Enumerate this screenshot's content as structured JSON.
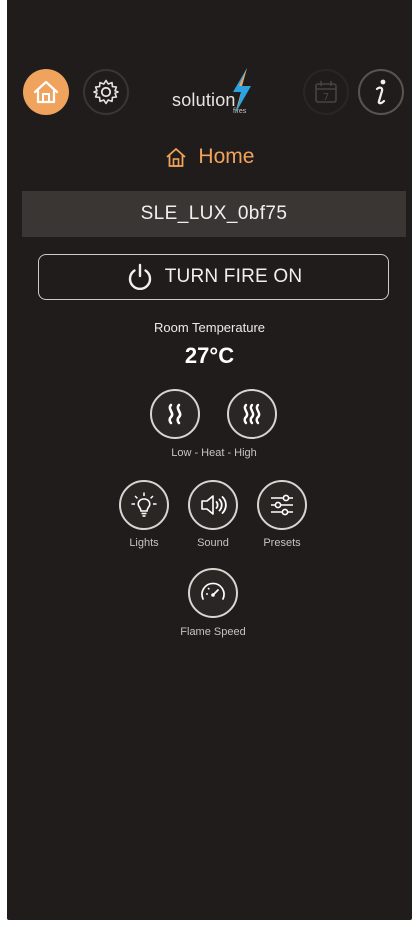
{
  "header": {
    "logo_text": "solution",
    "logo_sub": "fires",
    "calendar_day": "7",
    "icons": [
      "home-icon",
      "gear-icon",
      "calendar-icon",
      "info-icon"
    ]
  },
  "page": {
    "title": "Home",
    "title_icon": "home-icon"
  },
  "device": {
    "name": "SLE_LUX_0bf75"
  },
  "power": {
    "label": "TURN FIRE ON",
    "icon": "power-icon"
  },
  "temperature": {
    "label": "Room Temperature",
    "value": "27°C"
  },
  "controls": {
    "heat_caption": "Low - Heat - High",
    "lights_label": "Lights",
    "sound_label": "Sound",
    "presets_label": "Presets",
    "flame_speed_label": "Flame Speed"
  },
  "colors": {
    "background": "#1f1c1b",
    "accent": "#f0a35c",
    "device_bar": "#3a3634"
  }
}
